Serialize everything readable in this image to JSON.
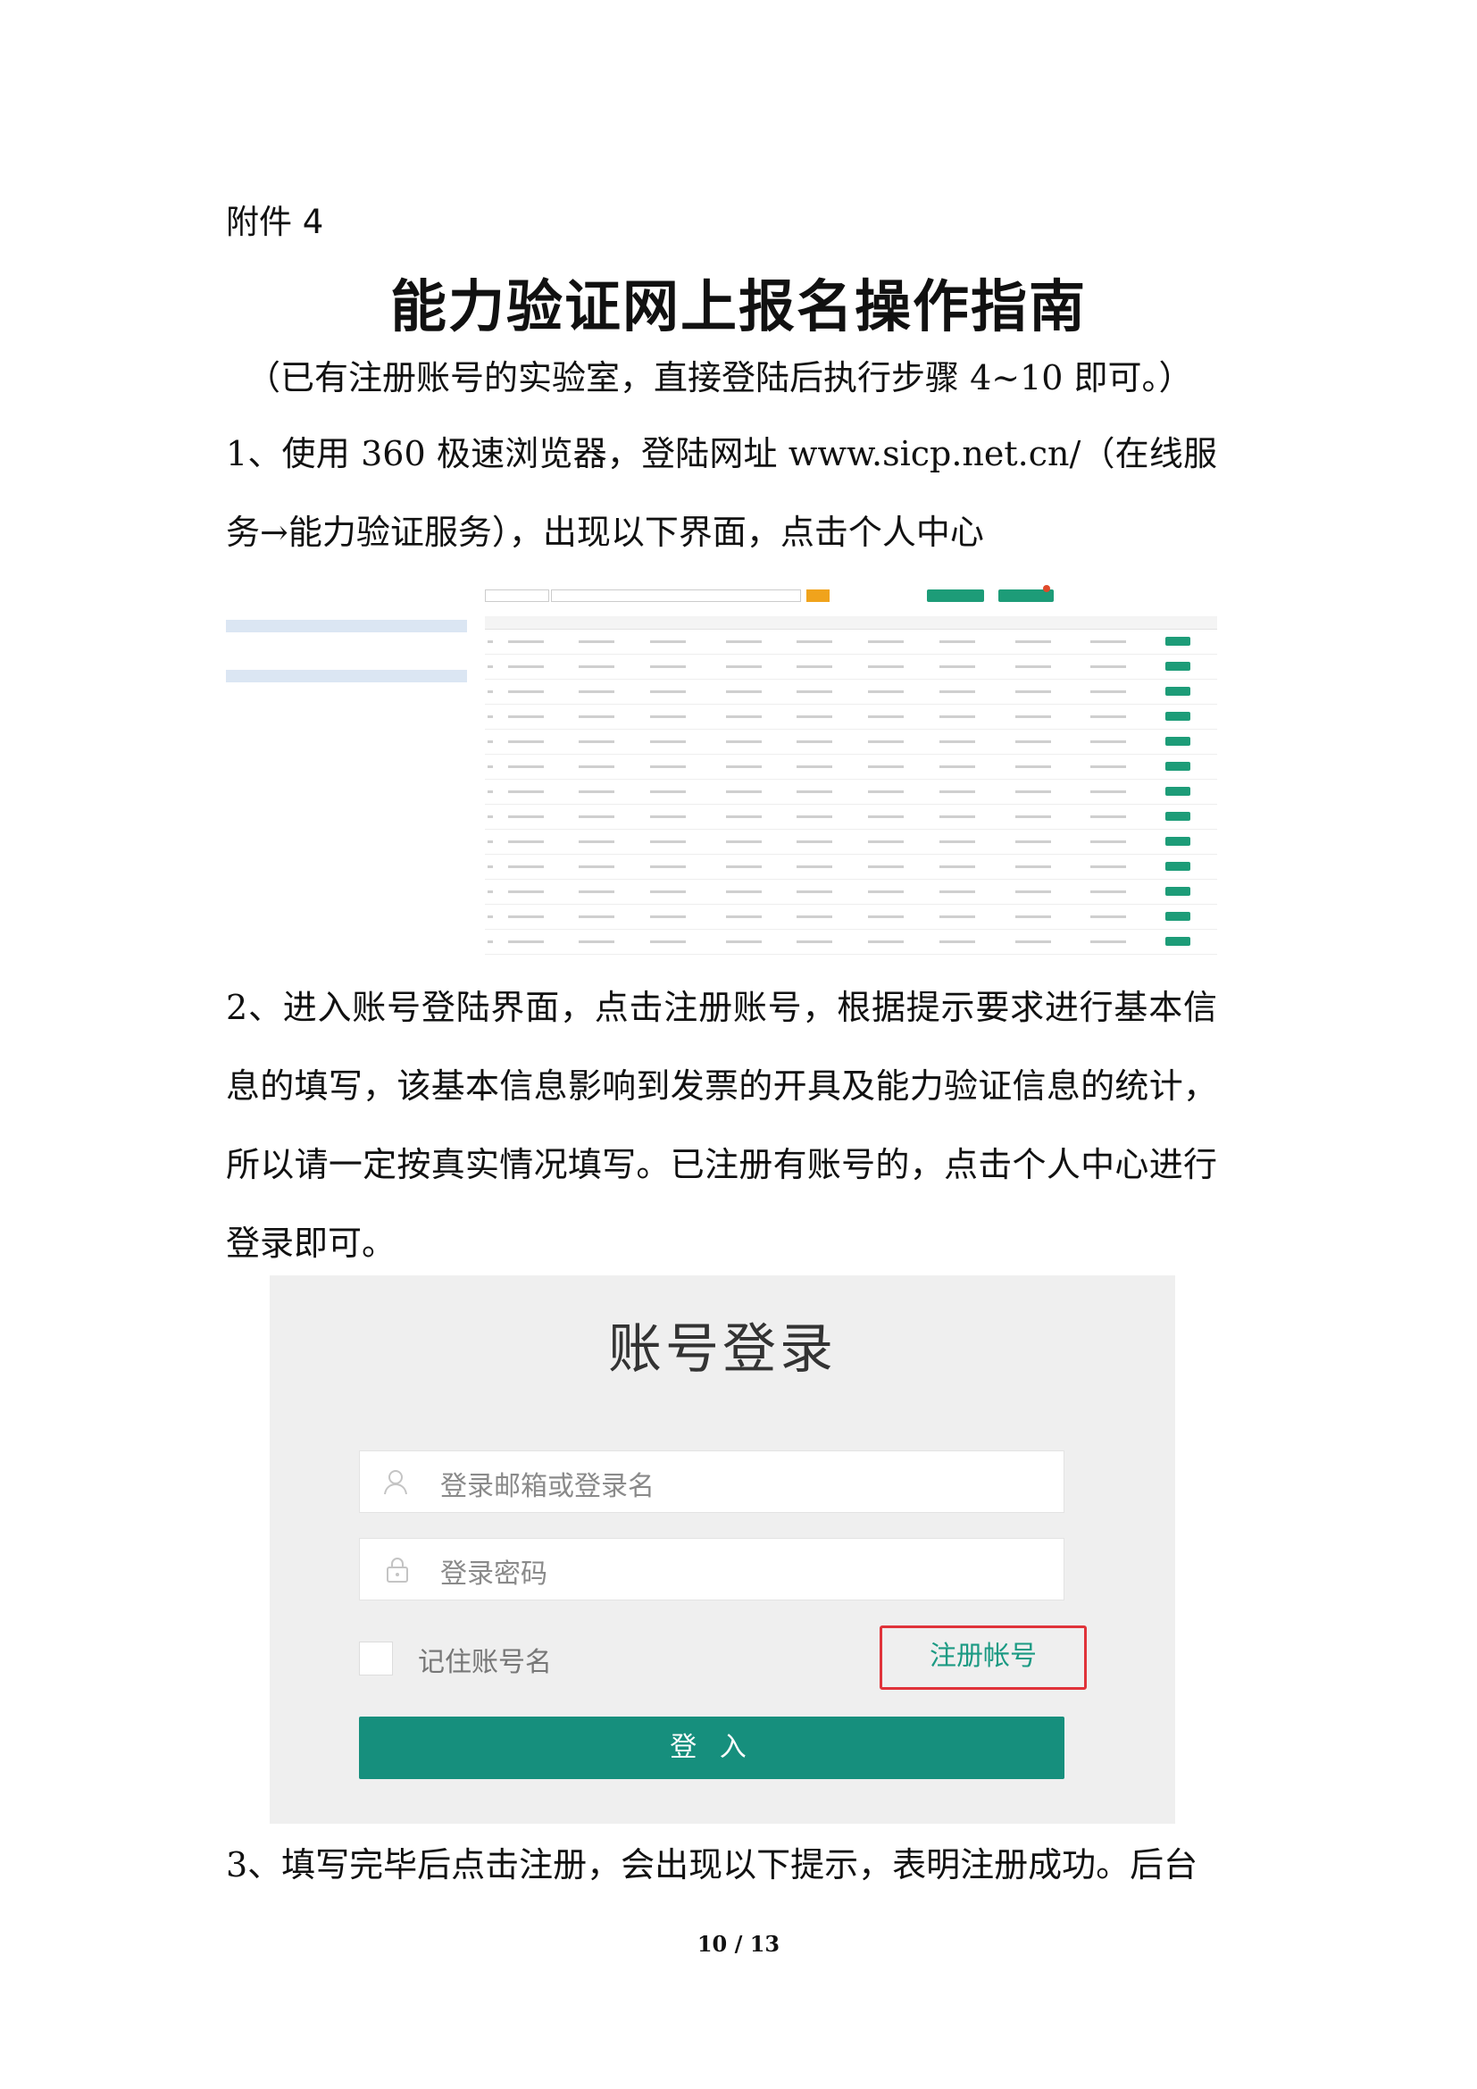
{
  "doc": {
    "attachment_label": "附件 4",
    "title": "能力验证网上报名操作指南",
    "subtitle": "（已有注册账号的实验室，直接登陆后执行步骤 4~10 即可。）",
    "step1": "1、使用 360 极速浏览器，登陆网址 www.sicp.net.cn/（在线服务→能力验证服务），出现以下界面，点击个人中心",
    "step2": "2、进入账号登陆界面，点击注册账号，根据提示要求进行基本信息的填写，该基本信息影响到发票的开具及能力验证信息的统计，所以请一定按真实情况填写。已注册有账号的，点击个人中心进行登录即可。",
    "step3": "3、填写完毕后点击注册，会出现以下提示，表明注册成功。后台",
    "page_number": "10 / 13"
  },
  "login": {
    "title": "账号登录",
    "username_placeholder": "登录邮箱或登录名",
    "password_placeholder": "登录密码",
    "remember_label": "记住账号名",
    "register_label": "注册帐号",
    "submit_label": "登 入",
    "user_icon": "user-icon",
    "lock_icon": "lock-icon",
    "accent_color": "#168f7d",
    "highlight_color": "#e0333a"
  },
  "list_view": {
    "primary_color": "#1d9c78",
    "search_color": "#f0a31c",
    "row_count": 13
  }
}
